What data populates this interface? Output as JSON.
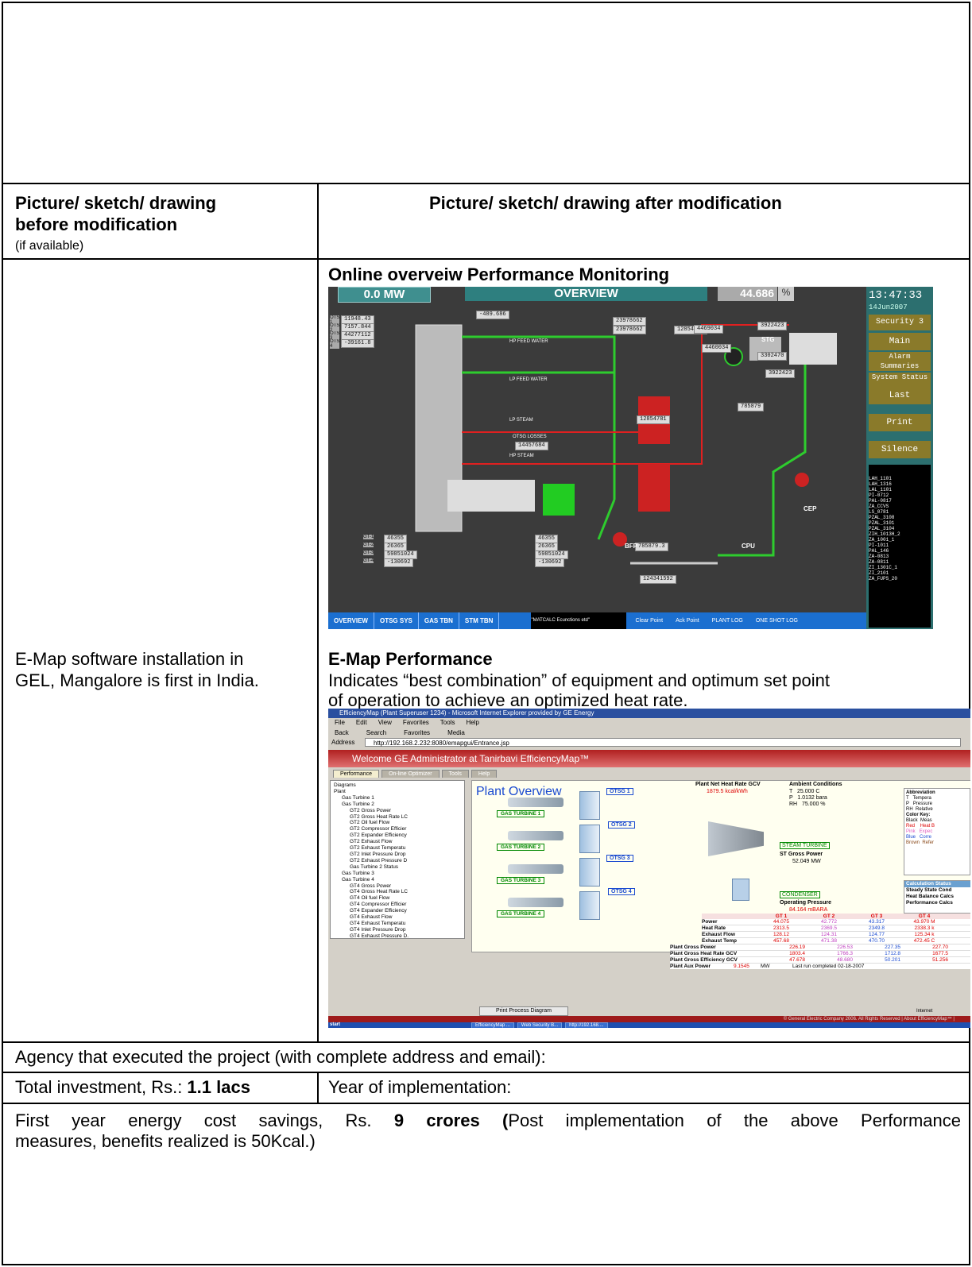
{
  "before_header": {
    "line1": "Picture/ sketch/ drawing",
    "line2": "before modification",
    "note": "(if available)"
  },
  "after_header": "Picture/ sketch/ drawing after modification",
  "left_text": {
    "line1": "E-Map software installation in",
    "line2": "GEL, Mangalore is first in India."
  },
  "section1_title": "Online overveiw Performance Monitoring",
  "section2": {
    "title": "E-Map Performance",
    "line1": "Indicates “best combination” of equipment and optimum set point",
    "line2": "of operation to achieve an optimized heat rate."
  },
  "agency_text": "Agency that executed the project (with complete address and email):",
  "investment": {
    "label": "Total investment, Rs.: ",
    "value": "1.1 lacs"
  },
  "year_label": "Year of implementation:",
  "savings": {
    "p1": "First year energy cost savings, Rs. ",
    "value": "9 crores (",
    "p2": "Post implementation of the above Performance",
    "p3": "measures, benefits realized is 50Kcal.)"
  },
  "scada": {
    "mw": "0.0  MW",
    "title": "OVERVIEW",
    "pct": "44.686",
    "pct_unit": "%",
    "time": "13:47:33",
    "date": "14Jun2007",
    "side_buttons": [
      "Security 3",
      "Main",
      "Alarm Summaries",
      "System Status",
      "Last",
      "Print",
      "Silence"
    ],
    "stack_top": "-489.686",
    "labels": [
      "HP FEED WATER",
      "LP FEED WATER",
      "LP STEAM",
      "HP STEAM",
      "OTSG LOSSES"
    ],
    "values": [
      "11948.43",
      "7157.844",
      "44277112",
      "-39161.8",
      "23978662",
      "23978662",
      "12854781",
      "4469034",
      "3922423",
      "4460034",
      "3302470",
      "3922423",
      "785879",
      "12854781",
      "14457684",
      "46355",
      "26365",
      "59851024",
      "-130692",
      "46355",
      "26365",
      "59851024",
      "-130692",
      "785879.3",
      "124341592"
    ],
    "left_tags": [
      "OTSG-1",
      "OTSG-2",
      "OTSG-3",
      "OTSG-4"
    ],
    "gt_tags": [
      "GT-1",
      "GT-2",
      "GT-3",
      "GT-4"
    ],
    "equip": [
      "STG",
      "BFP",
      "CEP",
      "CPU"
    ],
    "bottom_tabs": [
      "OVERVIEW",
      "OTSG SYS",
      "GAS TBN",
      "STM TBN"
    ],
    "bottom_right": [
      "Clear Point",
      "Ack Point",
      "PLANT LOG",
      "ONE SHOT LOG"
    ],
    "msg": "\"MATCALC Ecunctions etd\"",
    "alarms": [
      "LAH_1101",
      "LAH_1316",
      "LAL_1101",
      "PI-0712",
      "PAL-0817",
      "ZA_CCVS",
      "LS_0781",
      "PZAL_3108",
      "PZAL_3101",
      "PZAL_3104",
      "ZIH_1013H_2",
      "ZA_1001_1",
      "PI-1011",
      "PAL_146",
      "ZA-0813",
      "ZA-0811",
      "ZI_1301C_1",
      "ZI_2101",
      "ZA_FUPS_20"
    ]
  },
  "emap": {
    "titlebar": "EfficiencyMap (Plant Superuser 1234) - Microsoft Internet Explorer provided by GE Energy",
    "menu": [
      "File",
      "Edit",
      "View",
      "Favorites",
      "Tools",
      "Help"
    ],
    "toolbar": [
      "Back",
      "Search",
      "Favorites",
      "Media"
    ],
    "address_label": "Address",
    "address": "http://192.168.2.232:8080/emapgui/Entrance.jsp",
    "welcome": "Welcome GE Administrator at Tanirbavi EfficiencyMap™",
    "tabs": [
      "Performance",
      "On-line Optimizer",
      "Tools",
      "Help"
    ],
    "tree": [
      "Diagrams",
      "Plant",
      "Gas Turbine 1",
      "Gas Turbine 2",
      "GT2 Gross Power",
      "GT2 Gross Heat Rate LC",
      "GT2 Oil fuel Flow",
      "GT2 Compressor Efficier",
      "GT2 Expander Efficiency",
      "GT2 Exhaust Flow",
      "GT2 Exhaust Temperatu",
      "GT2 Inlet Pressure Drop",
      "GT2 Exhaust Pressure D",
      "Gas Turbine 2 Status",
      "Gas Turbine 3",
      "Gas Turbine 4",
      "GT4 Gross Power",
      "GT4 Gross Heat Rate LC",
      "GT4 Oil fuel Flow",
      "GT4 Compressor Efficier",
      "GT4 Expander Efficiency",
      "GT4 Exhaust Flow",
      "GT4 Exhaust Temperatu",
      "GT4 Inlet Pressure Drop",
      "GT4 Exhaust Pressure D.",
      "Gas Turbine 4 Status",
      "OTSG 1",
      "HR1 HP Steam Flow",
      "HR1 LP Steam Flow",
      "HR1 Stack Temp",
      "HR1 Efficiency",
      "OTSG 1 Equipment Statu",
      "OTSG 2",
      "HR2 HP Steam Flow"
    ],
    "plant_overview": "Plant Overview",
    "otsg": [
      "OTSG 1",
      "OTSG 2",
      "OTSG 3",
      "OTSG 4"
    ],
    "gas_turbines": [
      "GAS TURBINE 1",
      "GAS TURBINE 2",
      "GAS TURBINE 3",
      "GAS TURBINE 4"
    ],
    "net_heat_rate_label": "Plant Net Heat Rate GCV",
    "net_heat_rate": "1879.5  kcal/kWh",
    "ambient_title": "Ambient Conditions",
    "ambient": [
      [
        "T",
        "25.000 C"
      ],
      [
        "P",
        "1.0132 bara"
      ],
      [
        "RH",
        "75.000 %"
      ]
    ],
    "abbrev_title": "Abbreviation",
    "abbrev": [
      "T   Tempera",
      "P   Pressure",
      "RH  Relative"
    ],
    "color_key_title": "Color Key:",
    "color_key": [
      "Black  Meas",
      "Red    Heat B",
      "Pink   Expec",
      "Blue   Corre",
      "Brown  Refer"
    ],
    "steam_turbine": "STEAM TURBINE",
    "st_gross_power_label": "ST Gross Power",
    "st_gross_power": "52.049  MW",
    "condenser": "CONDENSER",
    "op_pressure_label": "Operating Pressure",
    "op_pressure": "84.164  mBARA",
    "calc_title": "Calculation Status",
    "calc": [
      "Steady State Cond",
      "Heat Balance Calcs",
      "Performance Calcs"
    ],
    "gt_cols": [
      "GT 1",
      "GT 2",
      "GT 3",
      "GT 4"
    ],
    "gt_rows": [
      {
        "label": "Power",
        "vals": [
          "44.075",
          "42.772",
          "43.317",
          "43.970  M"
        ]
      },
      {
        "label": "Heat Rate",
        "vals": [
          "2313.5",
          "2369.5",
          "2349.8",
          "2338.3  k"
        ]
      },
      {
        "label": "Exhaust Flow",
        "vals": [
          "128.12",
          "124.31",
          "124.77",
          "125.34  k"
        ]
      },
      {
        "label": "Exhaust Temp",
        "vals": [
          "457.68",
          "471.38",
          "470.70",
          "472.45  C"
        ]
      }
    ],
    "plant_rows": [
      {
        "label": "Plant Gross Power",
        "vals": [
          "226.19",
          "226.53",
          "227.35",
          "227.70"
        ]
      },
      {
        "label": "Plant Gross Heat Rate GCV",
        "vals": [
          "1803.4",
          "1766.3",
          "1712.8",
          "1677.5"
        ]
      },
      {
        "label": "Plant Gross Efficiency GCV",
        "vals": [
          "47.678",
          "48.680",
          "50.201",
          "51.256"
        ]
      }
    ],
    "aux_label": "Plant Aux Power",
    "aux_value": "9.1545",
    "aux_unit": "MW",
    "last_run": "Last run completed  02-18-2007",
    "print_btn": "Print Process Diagram",
    "footer": "© General Electric Company 2006. All Rights Reserved  |  About EfficiencyMap™  |",
    "status": "Internet",
    "start": "start",
    "taskbar": [
      "EfficiencyMap ...",
      "Web Security B...",
      "http://192.168...."
    ]
  }
}
